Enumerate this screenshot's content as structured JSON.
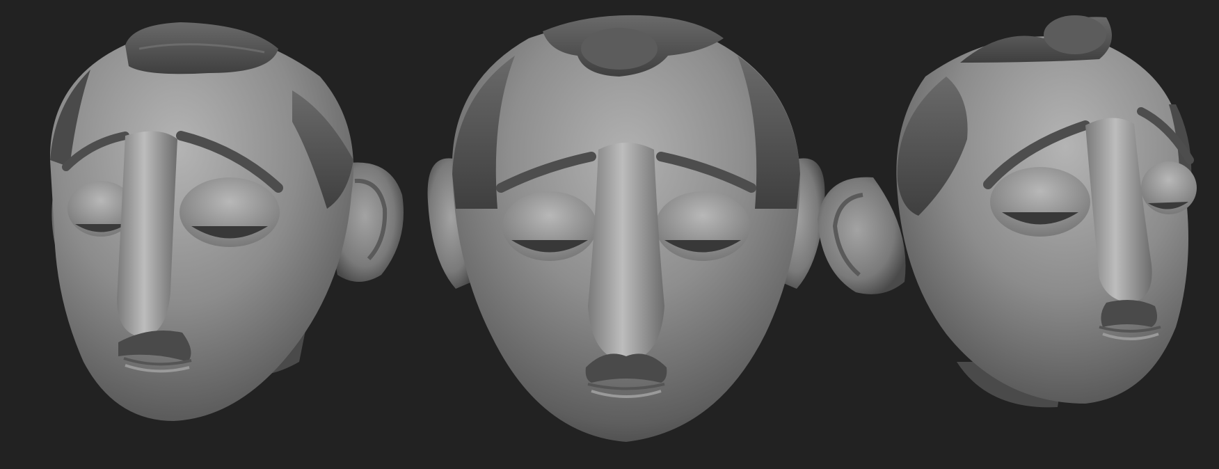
{
  "scene": {
    "background": "#222222",
    "material": "matte-gray-sculpt",
    "subject": "caricature-head-sculpt",
    "views": [
      {
        "id": "view-three-quarter-left"
      },
      {
        "id": "view-front"
      },
      {
        "id": "view-three-quarter-right"
      }
    ]
  },
  "colors": {
    "skin_light": "#a9a9a9",
    "skin_mid": "#7d7d7d",
    "skin_dark": "#474747",
    "hair": "#4e4e4e",
    "hair_light": "#6a6a6a",
    "shadow": "#2c2c2c"
  }
}
